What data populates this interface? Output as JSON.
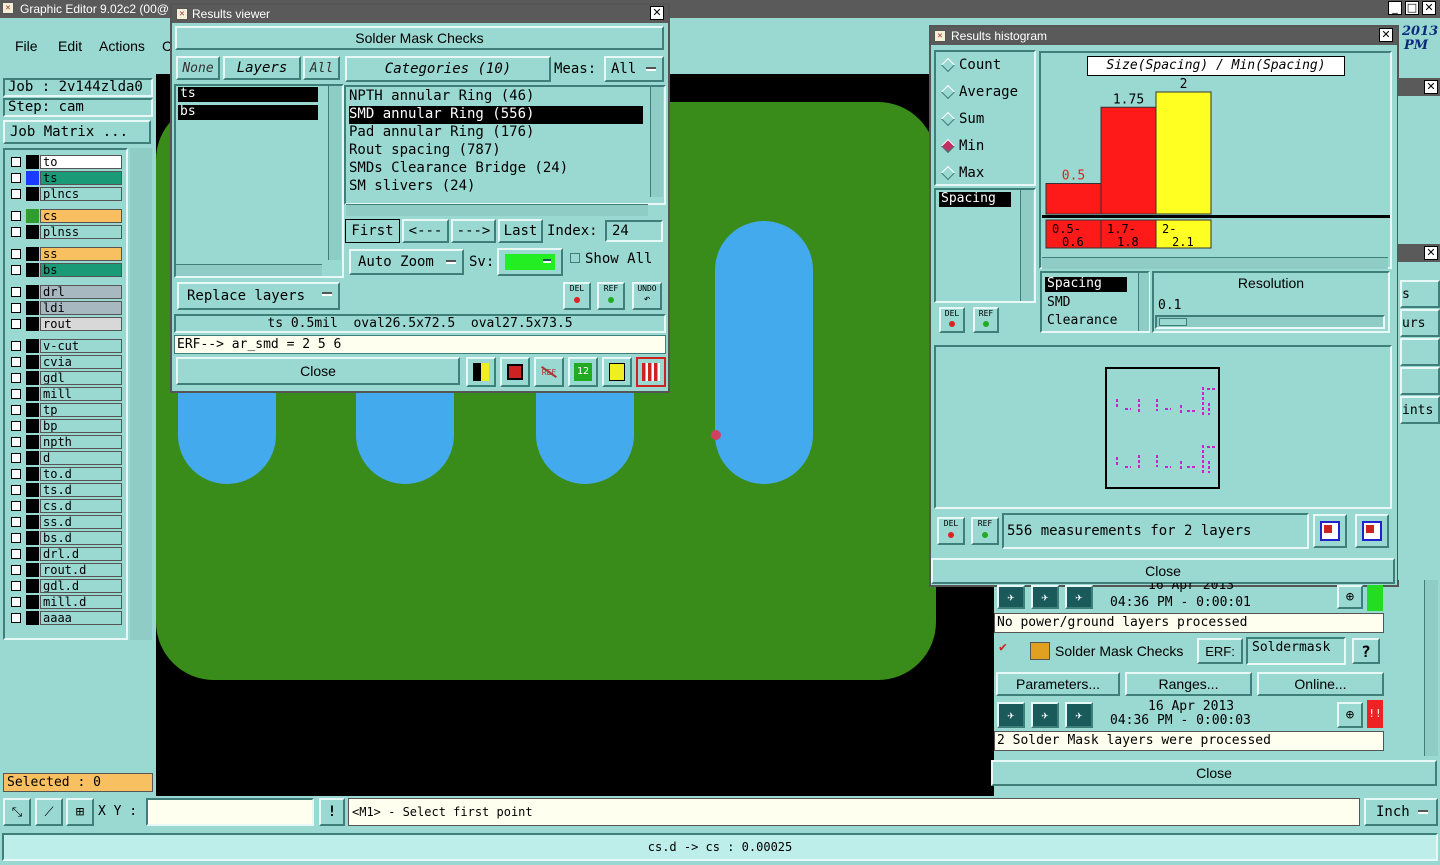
{
  "main_window": {
    "title": "Graphic Editor 9.02c2 (00@",
    "menu": [
      "File",
      "Edit",
      "Actions",
      "C"
    ],
    "clock_lines": [
      "2013",
      "PM"
    ]
  },
  "left_panel": {
    "job": "Job : 2v144zlda0",
    "step": "Step: cam",
    "job_matrix": "Job Matrix ...",
    "layers": [
      {
        "name": "to",
        "bg": "#ffffff",
        "swatch": "#000000"
      },
      {
        "name": "ts",
        "bg": "#1a9a77",
        "swatch": "#1a3cff"
      },
      {
        "name": "plncs",
        "bg": "#9ad8d2",
        "swatch": "#000000"
      },
      {
        "name": "cs",
        "bg": "#f8c060",
        "swatch": "#2f9e2f"
      },
      {
        "name": "plnss",
        "bg": "#9ad8d2",
        "swatch": "#000000"
      },
      {
        "name": "ss",
        "bg": "#f8c060",
        "swatch": "#000000"
      },
      {
        "name": "bs",
        "bg": "#1a9a77",
        "swatch": "#000000"
      },
      {
        "name": "drl",
        "bg": "#a8b8c0",
        "swatch": "#000000"
      },
      {
        "name": "ldi",
        "bg": "#a8b8c0",
        "swatch": "#000000"
      },
      {
        "name": "rout",
        "bg": "#d8d8d8",
        "swatch": "#000000"
      },
      {
        "name": "v-cut",
        "bg": "#9ad8d2",
        "swatch": "#000000"
      },
      {
        "name": "cvia",
        "bg": "#9ad8d2",
        "swatch": "#000000"
      },
      {
        "name": "gdl",
        "bg": "#9ad8d2",
        "swatch": "#000000"
      },
      {
        "name": "mill",
        "bg": "#9ad8d2",
        "swatch": "#000000"
      },
      {
        "name": "tp",
        "bg": "#9ad8d2",
        "swatch": "#000000"
      },
      {
        "name": "bp",
        "bg": "#9ad8d2",
        "swatch": "#000000"
      },
      {
        "name": "npth",
        "bg": "#9ad8d2",
        "swatch": "#000000"
      },
      {
        "name": "d",
        "bg": "#9ad8d2",
        "swatch": "#000000"
      },
      {
        "name": "to.d",
        "bg": "#9ad8d2",
        "swatch": "#000000"
      },
      {
        "name": "ts.d",
        "bg": "#9ad8d2",
        "swatch": "#000000"
      },
      {
        "name": "cs.d",
        "bg": "#9ad8d2",
        "swatch": "#000000"
      },
      {
        "name": "ss.d",
        "bg": "#9ad8d2",
        "swatch": "#000000"
      },
      {
        "name": "bs.d",
        "bg": "#9ad8d2",
        "swatch": "#000000"
      },
      {
        "name": "drl.d",
        "bg": "#9ad8d2",
        "swatch": "#000000"
      },
      {
        "name": "rout.d",
        "bg": "#9ad8d2",
        "swatch": "#000000"
      },
      {
        "name": "gdl.d",
        "bg": "#9ad8d2",
        "swatch": "#000000"
      },
      {
        "name": "mill.d",
        "bg": "#9ad8d2",
        "swatch": "#000000"
      },
      {
        "name": "aaaa",
        "bg": "#9ad8d2",
        "swatch": "#000000"
      }
    ],
    "selected": "Selected : 0"
  },
  "results_viewer": {
    "title": "Results viewer",
    "header": "Solder Mask Checks",
    "none": "None",
    "layers": "Layers",
    "all": "All",
    "layer_items": [
      "ts",
      "bs"
    ],
    "categories": "Categories (10)",
    "meas_label": "Meas:",
    "meas_value": "All",
    "category_items": [
      "NPTH annular Ring (46)",
      "SMD annular Ring (556)",
      "Pad annular Ring (176)",
      "Rout spacing (787)",
      "SMDs Clearance Bridge (24)",
      "SM slivers (24)"
    ],
    "first": "First",
    "prev": "<---",
    "next": "--->",
    "last": "Last",
    "index_label": "Index:",
    "index_value": "24",
    "auto_zoom": "Auto Zoom",
    "sv_label": "Sv:",
    "show_all": "Show All",
    "replace_layers": "Replace layers",
    "del": "DEL",
    "ref": "REF",
    "undo": "UNDO",
    "status": "ts 0.5mil  oval26.5x72.5  oval27.5x73.5",
    "erf": "ERF--> ar_smd = 2 5 6",
    "close": "Close"
  },
  "histogram": {
    "title": "Results histogram",
    "modes": [
      "Count",
      "Average",
      "Sum",
      "Min",
      "Max"
    ],
    "selected_mode": "Min",
    "type_items": [
      "Spacing"
    ],
    "chart_title": "Size(Spacing) / Min(Spacing)",
    "chart_data": {
      "type": "bar",
      "categories": [
        "0.5-\n0.6",
        "1.7-\n1.8",
        "2-\n2.1"
      ],
      "values": [
        0.5,
        1.75,
        2
      ],
      "value_labels": [
        "0.5",
        "1.75",
        "2"
      ],
      "colors": [
        "#ff1a1a",
        "#ff1a1a",
        "#ffff22"
      ],
      "ylim": [
        0,
        2
      ]
    },
    "bin_labels": [
      "0.5-",
      "0.6",
      "1.7-",
      "1.8",
      "2-",
      "2.1"
    ],
    "filter_items": [
      "Spacing",
      "SMD",
      "Clearance"
    ],
    "resolution_label": "Resolution",
    "resolution_value": "0.1",
    "del": "DEL",
    "ref": "REF",
    "summary": "556 measurements for 2 layers",
    "close": "Close"
  },
  "checklist": {
    "date1": "16 Apr 2013",
    "time1": "04:36 PM - 0:00:01",
    "msg1": "No power/ground layers processed",
    "check_name": "Solder Mask Checks",
    "erf_label": "ERF:",
    "erf_value": "Soldermask",
    "help": "?",
    "parameters": "Parameters...",
    "ranges": "Ranges...",
    "online": "Online...",
    "date2": "16 Apr 2013",
    "time2": "04:36 PM - 0:00:03",
    "msg2": "2 Solder Mask layers were processed",
    "close": "Close",
    "side_labels": [
      "s",
      "urs",
      "ints"
    ]
  },
  "bottom": {
    "xy_label": "X Y :",
    "xy_value": "",
    "prompt": "<M1> - Select first point",
    "units": "Inch",
    "status": "cs.d -> cs : 0.00025"
  }
}
